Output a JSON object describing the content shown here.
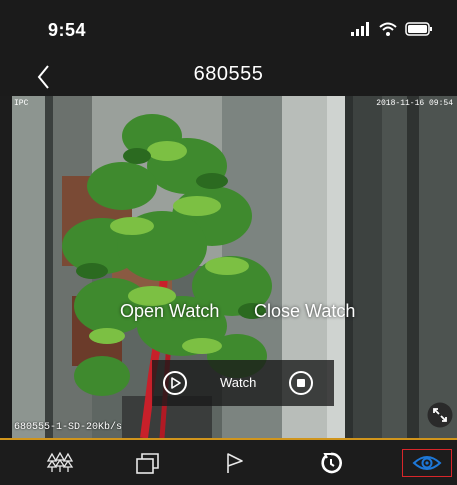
{
  "status_bar": {
    "time": "9:54",
    "icons": [
      "cellular-signal-icon",
      "wifi-icon",
      "battery-icon"
    ]
  },
  "nav": {
    "title": "680555",
    "back_icon": "chevron-left-icon"
  },
  "video": {
    "camera_label": "IPC",
    "timestamp": "2018-11-16 09:54",
    "stream_info": "680555-1-SD-20Kb/s",
    "open_watch_label": "Open Watch",
    "close_watch_label": "Close Watch",
    "watch_panel": {
      "play_icon": "play-icon",
      "label": "Watch",
      "stop_icon": "stop-icon"
    },
    "fullscreen_icon": "fullscreen-icon"
  },
  "toolbar": {
    "items": [
      {
        "icon": "trees-icon",
        "selected": false
      },
      {
        "icon": "multi-window-icon",
        "selected": false
      },
      {
        "icon": "flag-icon",
        "selected": false
      },
      {
        "icon": "timer-icon",
        "selected": false
      },
      {
        "icon": "eye-icon",
        "selected": true
      }
    ]
  },
  "colors": {
    "background": "#1c1c1c",
    "accent_gold": "#d0951c",
    "selected_border": "#d8262a",
    "eye_icon": "#1e78d8",
    "plant_red_stem": "#c8202a"
  }
}
